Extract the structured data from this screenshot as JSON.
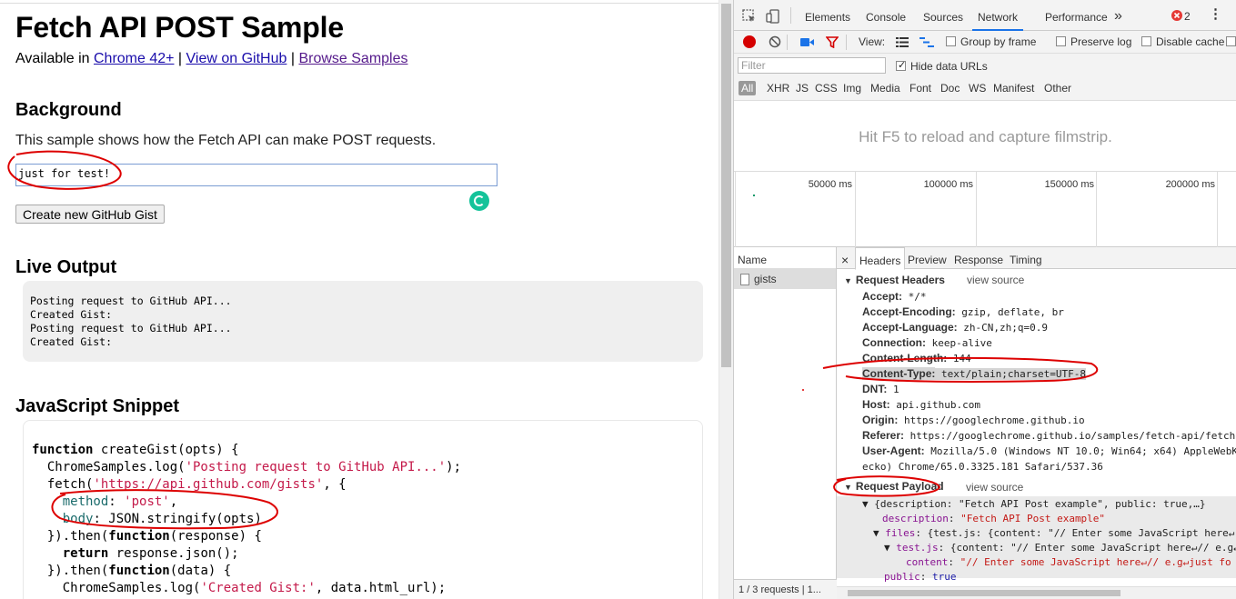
{
  "page": {
    "title": "Fetch API POST Sample",
    "available_prefix": "Available in ",
    "chrome_link": "Chrome 42+",
    "sep1": " | ",
    "github_link": "View on GitHub",
    "sep2": " | ",
    "browse_link": "Browse Samples",
    "background_heading": "Background",
    "background_text": "This sample shows how the Fetch API can make POST requests.",
    "gist_input_value": "just for test!",
    "create_button": "Create new GitHub Gist",
    "live_output_heading": "Live Output",
    "output_lines": [
      "Posting request to GitHub API...",
      "Created Gist:",
      "Posting request to GitHub API...",
      "Created Gist:"
    ],
    "snippet_heading": "JavaScript Snippet",
    "snippet": {
      "l1_kw": "function",
      "l1_rest": " createGist(opts) {",
      "l2_a": "  ChromeSamples.log(",
      "l2_str": "'Posting request to GitHub API...'",
      "l2_b": ");",
      "l3_a": "  fetch(",
      "l3_str": "'https://api.github.com/gists'",
      "l3_b": ", {",
      "l4_prop": "    method",
      "l4_a": ": ",
      "l4_str": "'post'",
      "l4_b": ",",
      "l5_prop": "    body",
      "l5_a": ": JSON.stringify(opts)",
      "l6_a": "  }).then(",
      "l6_kw": "function",
      "l6_b": "(response) {",
      "l7_kw": "    return",
      "l7_a": " response.json();",
      "l8_a": "  }).then(",
      "l8_kw": "function",
      "l8_b": "(data) {",
      "l9_a": "    ChromeSamples.log(",
      "l9_str": "'Created Gist:'",
      "l9_b": ", data.html_url);"
    }
  },
  "devtools": {
    "tabs": [
      "Elements",
      "Console",
      "Sources",
      "Network",
      "Performance"
    ],
    "more_tabs": "»",
    "error_count": "2",
    "toolbar": {
      "view_label": "View:",
      "group_by_frame": "Group by frame",
      "preserve_log": "Preserve log",
      "disable_cache": "Disable cache"
    },
    "filter_placeholder": "Filter",
    "hide_data_urls": "Hide data URLs",
    "types": [
      "All",
      "XHR",
      "JS",
      "CSS",
      "Img",
      "Media",
      "Font",
      "Doc",
      "WS",
      "Manifest",
      "Other"
    ],
    "filmstrip_hint": "Hit F5 to reload and capture filmstrip.",
    "timeline_labels": [
      "50000 ms",
      "100000 ms",
      "150000 ms",
      "200000 ms"
    ],
    "name_header": "Name",
    "request_name": "gists",
    "status_text": "1 / 3 requests | 1...",
    "detail_tabs": [
      "Headers",
      "Preview",
      "Response",
      "Timing"
    ],
    "close_glyph": "×",
    "request_headers_title": "Request Headers",
    "view_source": "view source",
    "headers": [
      {
        "k": "Accept:",
        "v": " */*"
      },
      {
        "k": "Accept-Encoding:",
        "v": " gzip, deflate, br"
      },
      {
        "k": "Accept-Language:",
        "v": " zh-CN,zh;q=0.9"
      },
      {
        "k": "Connection:",
        "v": " keep-alive"
      },
      {
        "k": "Content-Length:",
        "v": " 144"
      },
      {
        "k": "Content-Type:",
        "v": " text/plain;charset=UTF-8"
      },
      {
        "k": "DNT:",
        "v": " 1"
      },
      {
        "k": "Host:",
        "v": " api.github.com"
      },
      {
        "k": "Origin:",
        "v": " https://googlechrome.github.io"
      },
      {
        "k": "Referer:",
        "v": " https://googlechrome.github.io/samples/fetch-api/fetch-"
      },
      {
        "k": "User-Agent:",
        "v": " Mozilla/5.0 (Windows NT 10.0; Win64; x64) AppleWebK"
      },
      {
        "k": "",
        "v": "ecko) Chrome/65.0.3325.181 Safari/537.36"
      }
    ],
    "payload_title": "Request Payload",
    "payload": {
      "p1": "▼ {description: \"Fetch API Post example\", public: true,…}",
      "p2_k": "description",
      "p2_v": "\"Fetch API Post example\"",
      "p3_k": "files",
      "p3_v": " {test.js: {content: \"// Enter some JavaScript here↵",
      "p4_k": "test.js",
      "p4_v": " {content: \"// Enter some JavaScript here↵// e.g↵",
      "p5_k": "content",
      "p5_v": "\"// Enter some JavaScript here↵// e.g↵just fo",
      "p6_k": "public",
      "p6_v": "true"
    }
  }
}
